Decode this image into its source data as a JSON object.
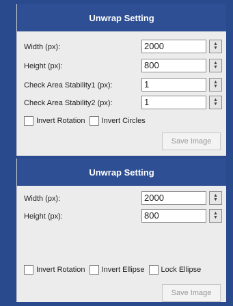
{
  "panels": [
    {
      "title": "Unwrap Setting",
      "fields": [
        {
          "label": "Width (px):",
          "value": "2000"
        },
        {
          "label": "Height (px):",
          "value": "800"
        },
        {
          "label": "Check Area Stability1 (px):",
          "value": "1"
        },
        {
          "label": "Check Area Stability2 (px):",
          "value": "1"
        }
      ],
      "checkboxes": [
        {
          "label": "Invert Rotation",
          "checked": false
        },
        {
          "label": "Invert Circles",
          "checked": false
        }
      ],
      "save_label": "Save Image"
    },
    {
      "title": "Unwrap Setting",
      "fields": [
        {
          "label": "Width (px):",
          "value": "2000"
        },
        {
          "label": "Height (px):",
          "value": "800"
        }
      ],
      "checkboxes": [
        {
          "label": "Invert Rotation",
          "checked": false
        },
        {
          "label": "Invert Ellipse",
          "checked": false
        },
        {
          "label": "Lock Ellipse",
          "checked": false
        }
      ],
      "save_label": "Save Image"
    }
  ],
  "colors": {
    "header": "#2e4f93",
    "panel": "#ececec"
  },
  "icons": {
    "spinner": "up-down-arrows-icon"
  }
}
